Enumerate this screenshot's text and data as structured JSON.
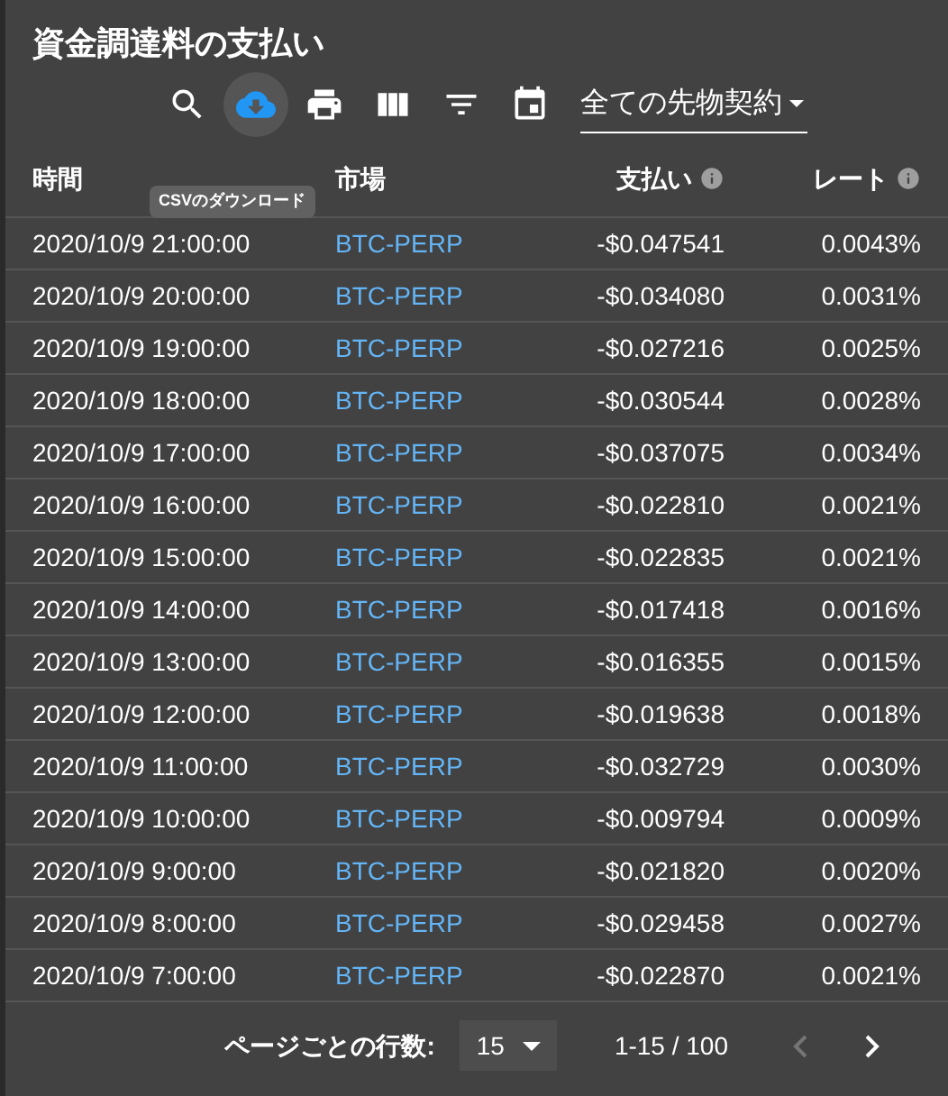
{
  "title": "資金調達料の支払い",
  "toolbar": [
    {
      "kind": "search",
      "selected": false
    },
    {
      "kind": "download",
      "selected": true
    },
    {
      "kind": "print",
      "selected": false
    },
    {
      "kind": "columns",
      "selected": false
    },
    {
      "kind": "filter",
      "selected": false
    },
    {
      "kind": "calendar",
      "selected": false
    }
  ],
  "tooltip": "CSVのダウンロード",
  "contract_select": {
    "value": "全ての先物契約"
  },
  "table": {
    "columns": [
      {
        "label": "時間",
        "info": false
      },
      {
        "label": "市場",
        "info": false
      },
      {
        "label": "支払い",
        "info": true
      },
      {
        "label": "レート",
        "info": true
      }
    ],
    "rows": [
      [
        "2020/10/9 21:00:00",
        "BTC-PERP",
        "-$0.047541",
        "0.0043%"
      ],
      [
        "2020/10/9 20:00:00",
        "BTC-PERP",
        "-$0.034080",
        "0.0031%"
      ],
      [
        "2020/10/9 19:00:00",
        "BTC-PERP",
        "-$0.027216",
        "0.0025%"
      ],
      [
        "2020/10/9 18:00:00",
        "BTC-PERP",
        "-$0.030544",
        "0.0028%"
      ],
      [
        "2020/10/9 17:00:00",
        "BTC-PERP",
        "-$0.037075",
        "0.0034%"
      ],
      [
        "2020/10/9 16:00:00",
        "BTC-PERP",
        "-$0.022810",
        "0.0021%"
      ],
      [
        "2020/10/9 15:00:00",
        "BTC-PERP",
        "-$0.022835",
        "0.0021%"
      ],
      [
        "2020/10/9 14:00:00",
        "BTC-PERP",
        "-$0.017418",
        "0.0016%"
      ],
      [
        "2020/10/9 13:00:00",
        "BTC-PERP",
        "-$0.016355",
        "0.0015%"
      ],
      [
        "2020/10/9 12:00:00",
        "BTC-PERP",
        "-$0.019638",
        "0.0018%"
      ],
      [
        "2020/10/9 11:00:00",
        "BTC-PERP",
        "-$0.032729",
        "0.0030%"
      ],
      [
        "2020/10/9 10:00:00",
        "BTC-PERP",
        "-$0.009794",
        "0.0009%"
      ],
      [
        "2020/10/9 9:00:00",
        "BTC-PERP",
        "-$0.021820",
        "0.0020%"
      ],
      [
        "2020/10/9 8:00:00",
        "BTC-PERP",
        "-$0.029458",
        "0.0027%"
      ],
      [
        "2020/10/9 7:00:00",
        "BTC-PERP",
        "-$0.022870",
        "0.0021%"
      ]
    ]
  },
  "pagination": {
    "rows_per_page_label": "ページごとの行数:",
    "rows_per_page": "15",
    "range": "1-15 / 100",
    "prev_disabled": true,
    "next_disabled": false
  }
}
